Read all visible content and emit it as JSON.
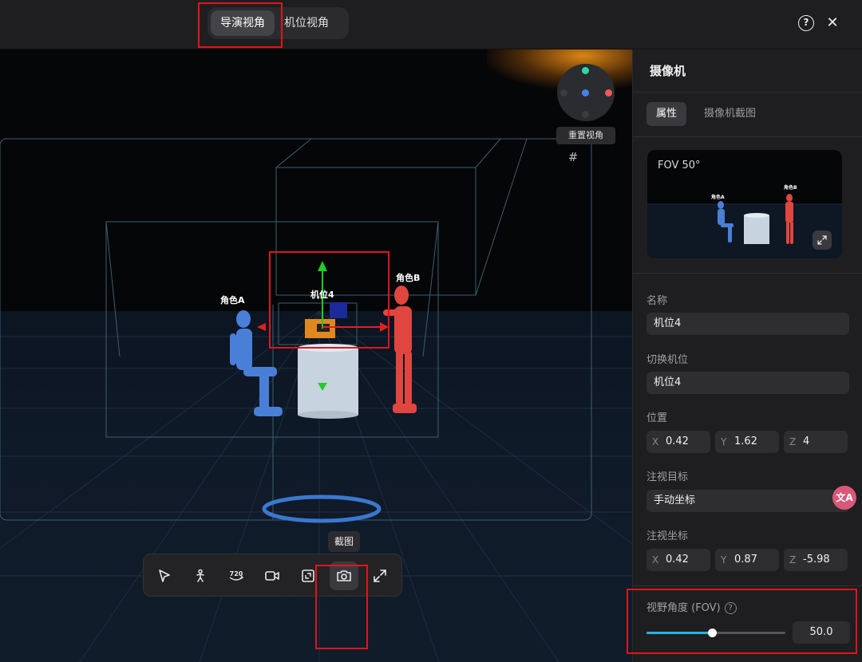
{
  "header": {
    "view_tabs": [
      {
        "label": "导演视角",
        "active": true
      },
      {
        "label": "机位视角",
        "active": false
      }
    ],
    "help_icon": "help-circle-icon",
    "close_icon": "close-icon"
  },
  "viewport": {
    "reset_view_label": "重置视角",
    "camera_label": "机位4",
    "character_a_label": "角色A",
    "character_b_label": "角色B",
    "tooltip": "截图",
    "tools": [
      {
        "name": "select-tool",
        "icon": "cursor-icon"
      },
      {
        "name": "character-tool",
        "icon": "person-icon"
      },
      {
        "name": "rotate-360-tool",
        "icon": "rotate-360-icon"
      },
      {
        "name": "camera-tool",
        "icon": "video-camera-icon"
      },
      {
        "name": "frame-tool",
        "icon": "frame-icon"
      },
      {
        "name": "screenshot-tool",
        "icon": "photo-camera-icon",
        "active": true
      },
      {
        "name": "fullscreen-tool",
        "icon": "expand-icon"
      }
    ],
    "colors": {
      "character_a": "#4a7fd8",
      "character_b": "#e0463f",
      "gizmo_y": "#22cc22",
      "gizmo_x": "#e02020"
    }
  },
  "panel": {
    "title": "摄像机",
    "tabs": [
      {
        "label": "属性",
        "active": true
      },
      {
        "label": "摄像机截图",
        "active": false
      }
    ],
    "preview": {
      "fov_text": "FOV 50°",
      "character_a_label": "角色A",
      "character_b_label": "角色B"
    },
    "name_label": "名称",
    "name_value": "机位4",
    "switch_label": "切换机位",
    "switch_value": "机位4",
    "position_label": "位置",
    "position": {
      "x_label": "X",
      "x": "0.42",
      "y_label": "Y",
      "y": "1.62",
      "z_label": "Z",
      "z": "4"
    },
    "look_target_label": "注视目标",
    "look_target_value": "手动坐标",
    "look_coord_label": "注视坐标",
    "look_coord": {
      "x_label": "X",
      "x": "0.42",
      "y_label": "Y",
      "y": "0.87",
      "z_label": "Z",
      "z": "-5.98"
    },
    "fov_label": "视野角度 (FOV)",
    "fov_help": "?",
    "fov_value": "50.0",
    "fov_slider_fraction": 0.47,
    "accent_color": "#29b2e8"
  }
}
